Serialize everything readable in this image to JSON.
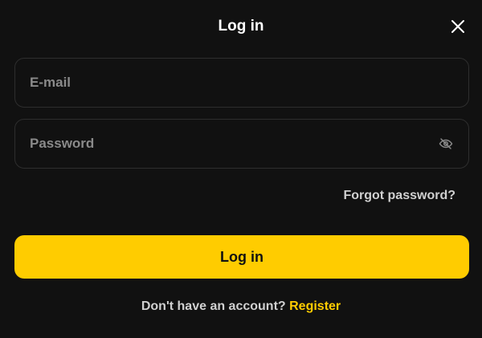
{
  "modal": {
    "title": "Log in",
    "close_icon": "close-icon"
  },
  "form": {
    "email": {
      "placeholder": "E-mail",
      "value": ""
    },
    "password": {
      "placeholder": "Password",
      "value": "",
      "toggle_icon": "eye-off-icon"
    },
    "forgot_label": "Forgot password?",
    "submit_label": "Log in"
  },
  "footer": {
    "prompt": "Don't have an account?",
    "register_label": "Register"
  },
  "colors": {
    "background": "#111111",
    "field_border": "#2e2e2e",
    "accent": "#ffcc00",
    "muted_text": "#8a8a8a",
    "secondary_text": "#d0d0d0"
  }
}
